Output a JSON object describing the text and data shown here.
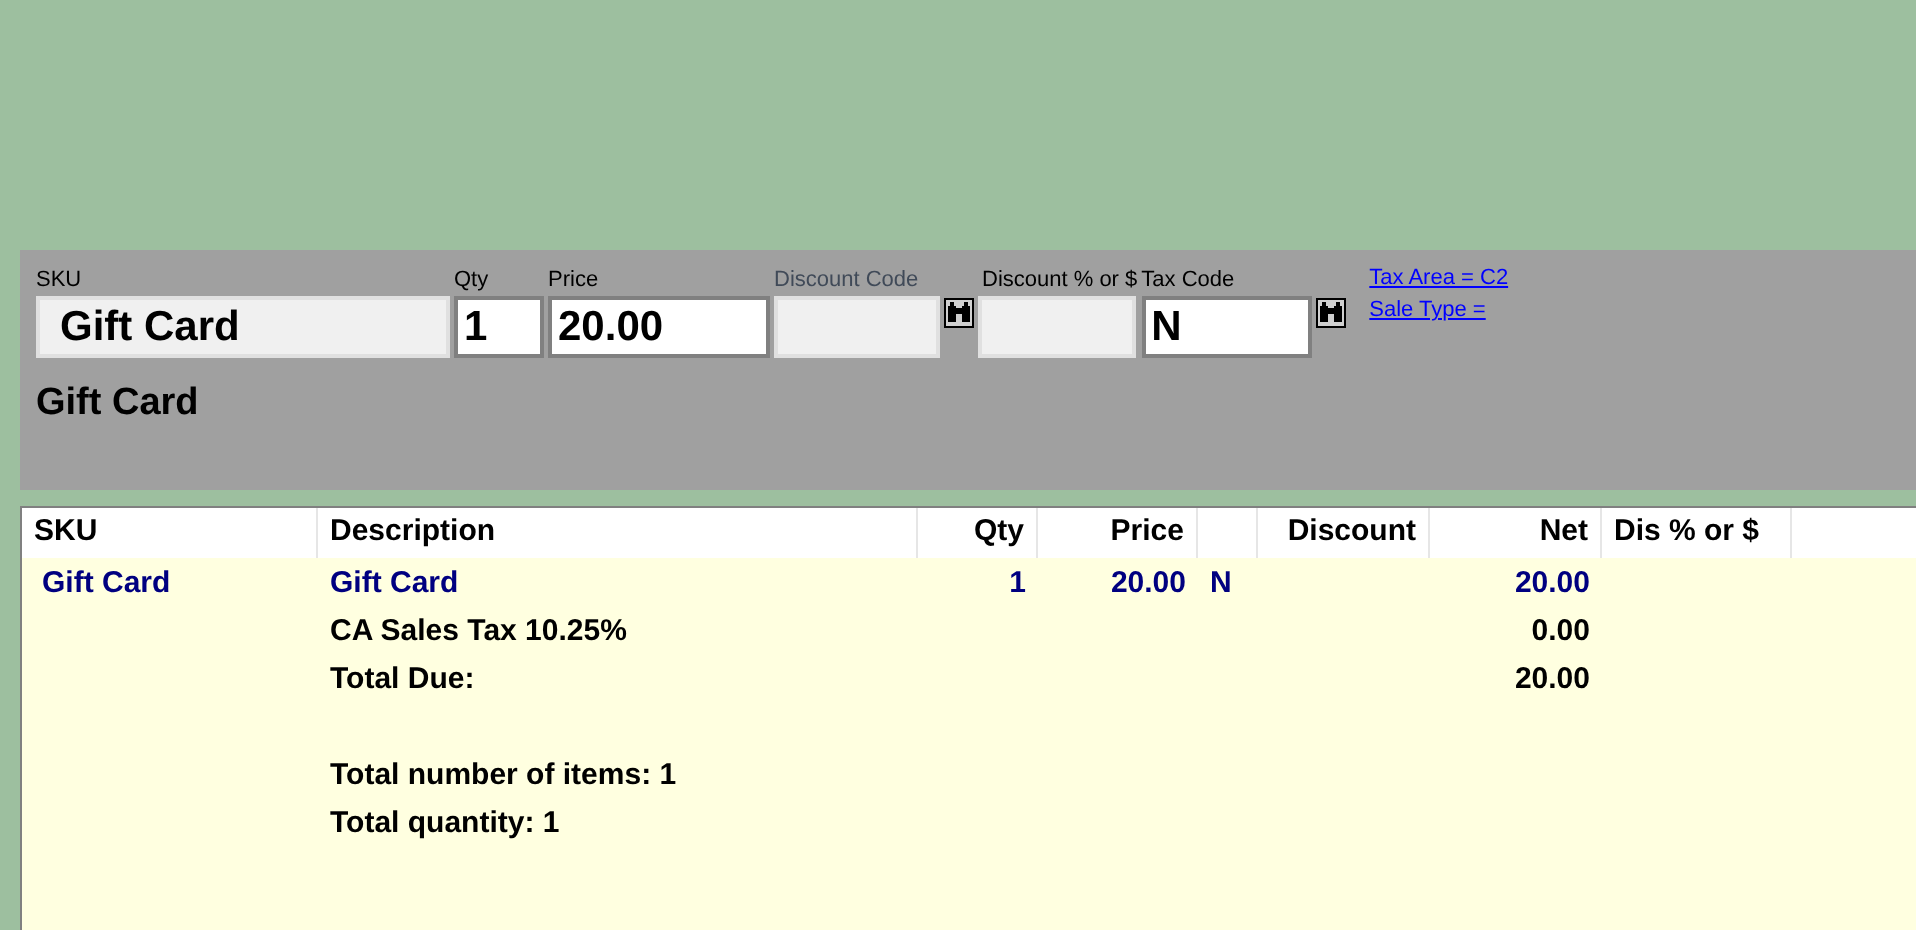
{
  "entry": {
    "fields": [
      {
        "label": "SKU",
        "value": "Gift Card",
        "disabled": true,
        "lookup": false
      },
      {
        "label": "Qty",
        "value": "1",
        "disabled": false,
        "lookup": false
      },
      {
        "label": "Price",
        "value": "20.00",
        "disabled": false,
        "lookup": false
      },
      {
        "label": "Discount Code",
        "disabled": true,
        "lookup": true
      },
      {
        "label": "Discount % or $",
        "disabled": true,
        "lookup": false
      },
      {
        "label": "Tax Code",
        "value": "N",
        "disabled": false,
        "lookup": true
      }
    ],
    "links": [
      "Tax Area = C2",
      "Sale Type ="
    ],
    "description": "Gift Card"
  },
  "table": {
    "columns": [
      "SKU",
      "Description",
      "Qty",
      "Price",
      "Discount",
      "Net",
      "Dis % or $"
    ],
    "rows": [
      {
        "kind": "item",
        "sku": "Gift Card",
        "description": "Gift Card",
        "qty": "1",
        "price": "20.00",
        "tax": "N",
        "net": "20.00"
      },
      {
        "kind": "summary",
        "description": "CA Sales Tax 10.25%",
        "net": "0.00"
      },
      {
        "kind": "summary",
        "description": "Total Due:",
        "net": "20.00"
      }
    ],
    "counts": [
      {
        "description": "Total number of items: 1"
      },
      {
        "description": "Total quantity: 1"
      }
    ]
  }
}
